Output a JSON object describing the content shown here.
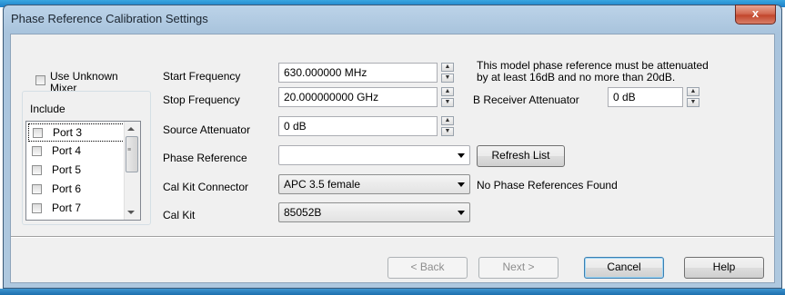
{
  "window": {
    "title": "Phase Reference Calibration Settings",
    "close_glyph": "x"
  },
  "left": {
    "use_unknown_mixer_label_line1": "Use Unknown",
    "use_unknown_mixer_label_line2": "Mixer",
    "use_unknown_mixer_checked": false,
    "include_label": "Include",
    "ports": [
      {
        "label": "Port 3",
        "checked": false
      },
      {
        "label": "Port 4",
        "checked": false
      },
      {
        "label": "Port 5",
        "checked": false
      },
      {
        "label": "Port 6",
        "checked": false
      },
      {
        "label": "Port 7",
        "checked": false
      }
    ]
  },
  "form": {
    "start_frequency_label": "Start Frequency",
    "start_frequency_value": "630.000000 MHz",
    "stop_frequency_label": "Stop Frequency",
    "stop_frequency_value": "20.000000000 GHz",
    "source_attenuator_label": "Source Attenuator",
    "source_attenuator_value": "0 dB",
    "phase_reference_label": "Phase Reference",
    "phase_reference_value": "",
    "refresh_list_label": "Refresh List",
    "cal_kit_connector_label": "Cal Kit Connector",
    "cal_kit_connector_value": "APC 3.5 female",
    "cal_kit_label": "Cal Kit",
    "cal_kit_value": "85052B"
  },
  "right": {
    "note_line1": "This model phase reference must be attenuated",
    "note_line2": "by at least 16dB and no more than 20dB.",
    "b_receiver_attenuator_label": "B Receiver Attenuator",
    "b_receiver_attenuator_value": "0 dB",
    "no_refs_message": "No Phase References Found"
  },
  "footer": {
    "back_label": "< Back",
    "next_label": "Next >",
    "cancel_label": "Cancel",
    "help_label": "Help"
  },
  "colors": {
    "title_bar": "#a9c4dd",
    "close_button": "#c2462c",
    "client_bg": "#f0f0f0"
  }
}
